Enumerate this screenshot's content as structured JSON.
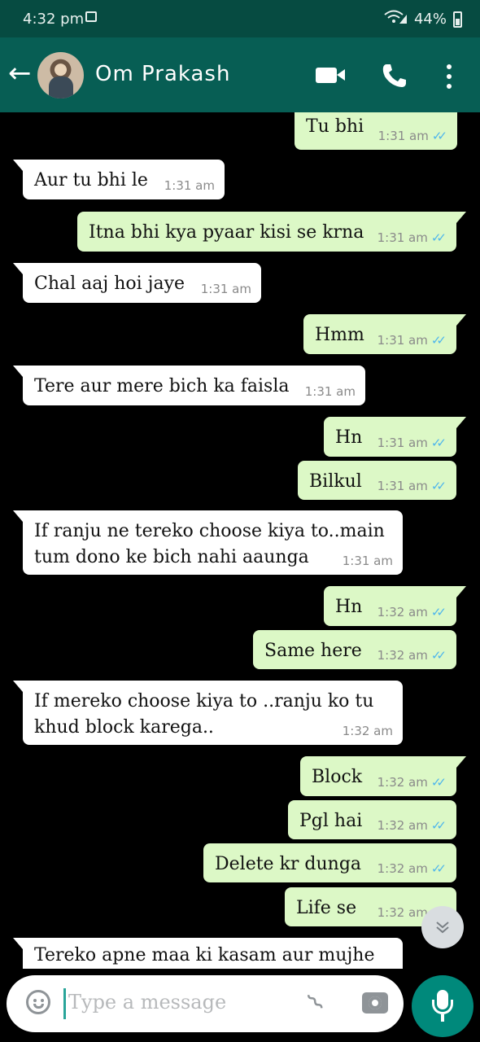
{
  "status_bar": {
    "time": "4:32 pm",
    "battery": "44%"
  },
  "header": {
    "contact_name": "Om Prakash"
  },
  "messages": [
    {
      "dir": "out",
      "text": "Tu bhi",
      "time": "1:31 am"
    },
    {
      "dir": "in",
      "text": "Aur tu bhi le",
      "time": "1:31 am"
    },
    {
      "dir": "out",
      "text": "Itna bhi kya pyaar kisi se krna",
      "time": "1:31 am"
    },
    {
      "dir": "in",
      "text": "Chal aaj hoi jaye",
      "time": "1:31 am"
    },
    {
      "dir": "out",
      "text": "Hmm",
      "time": "1:31 am"
    },
    {
      "dir": "in",
      "text": "Tere aur mere bich ka faisla",
      "time": "1:31 am"
    },
    {
      "dir": "out",
      "text": "Hn",
      "time": "1:31 am"
    },
    {
      "dir": "out",
      "text": "Bilkul",
      "time": "1:31 am"
    },
    {
      "dir": "in",
      "text": "If ranju ne tereko choose kiya to..main\ntum dono ke bich nahi aaunga",
      "time": "1:31 am"
    },
    {
      "dir": "out",
      "text": "Hn",
      "time": "1:32 am"
    },
    {
      "dir": "out",
      "text": "Same here",
      "time": "1:32 am"
    },
    {
      "dir": "in",
      "text": "If mereko choose kiya to ..ranju ko tu\nkhud block karega..",
      "time": "1:32 am"
    },
    {
      "dir": "out",
      "text": "Block",
      "time": "1:32 am"
    },
    {
      "dir": "out",
      "text": "Pgl hai",
      "time": "1:32 am"
    },
    {
      "dir": "out",
      "text": "Delete kr dunga",
      "time": "1:32 am"
    },
    {
      "dir": "out",
      "text": "Life se",
      "time": "1:32 am"
    },
    {
      "dir": "in",
      "text": "Tereko apne maa ki kasam aur mujhe",
      "time": ""
    }
  ],
  "composer": {
    "placeholder": "Type a message"
  }
}
